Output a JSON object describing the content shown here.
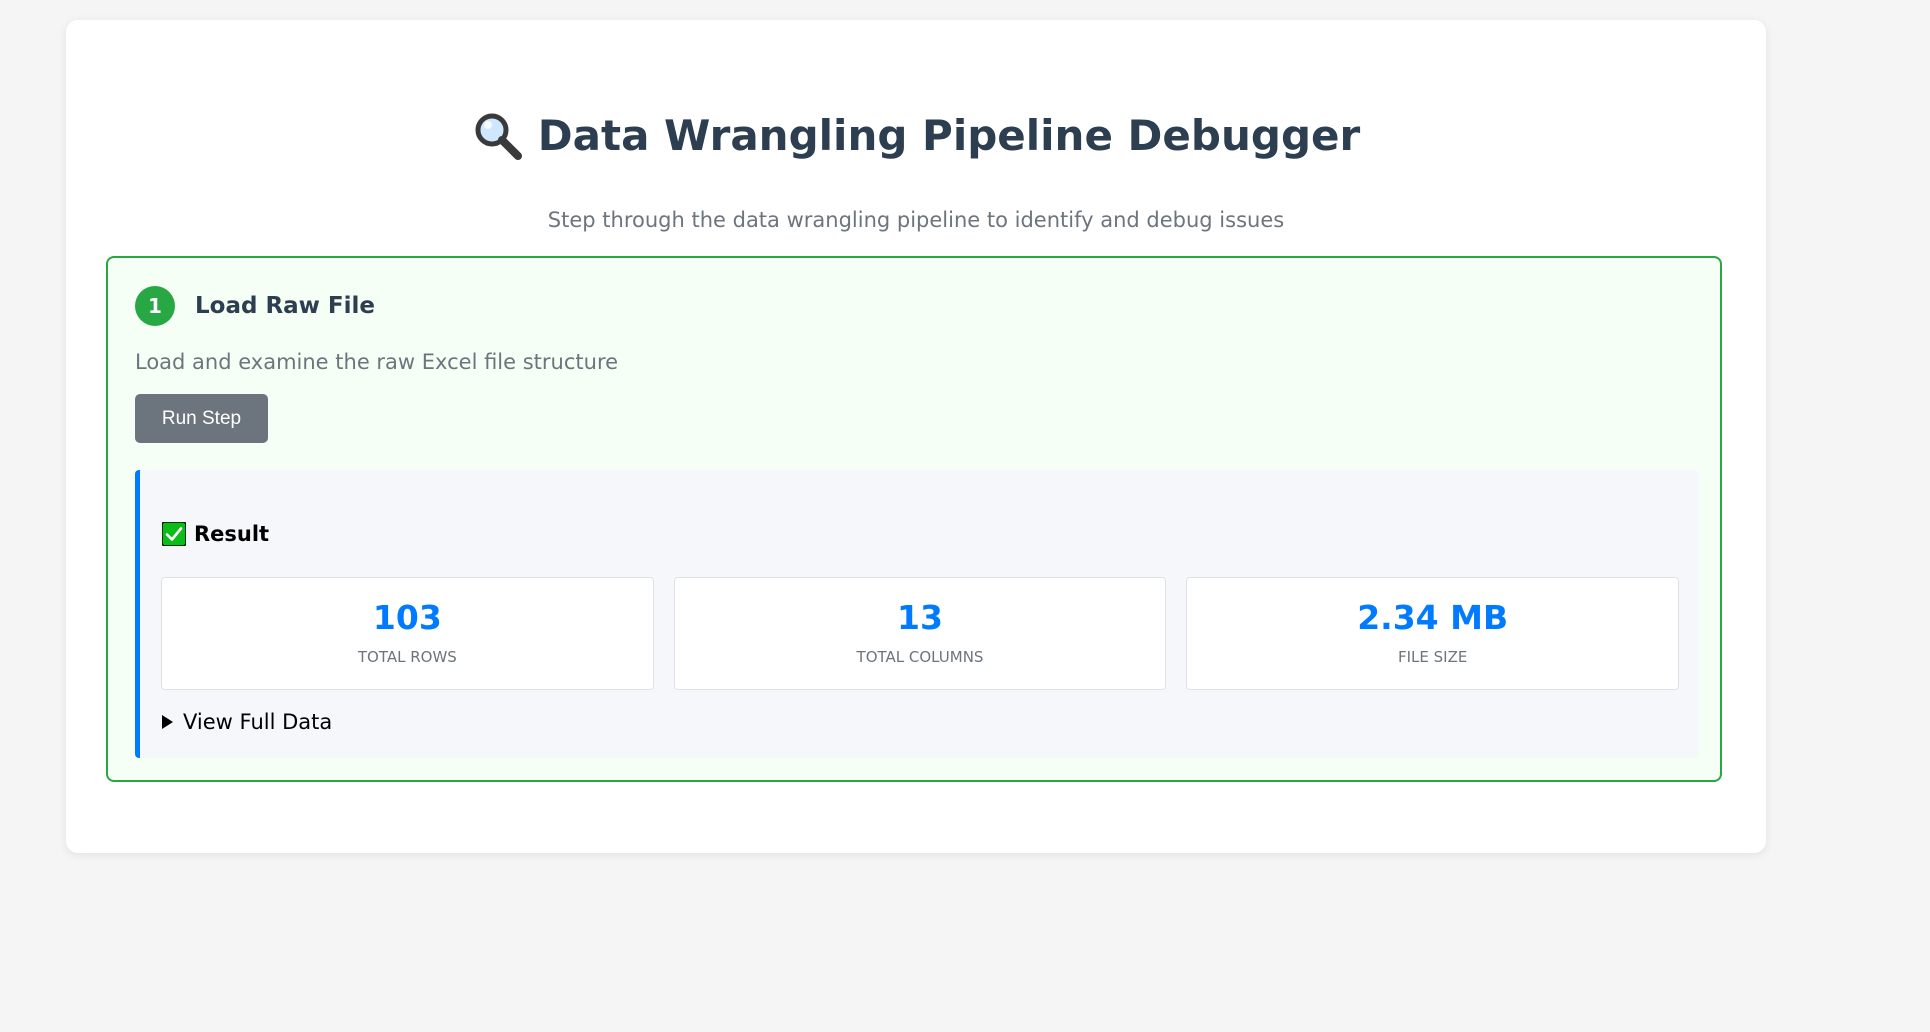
{
  "header": {
    "title": "Data Wrangling Pipeline Debugger",
    "title_icon": "magnifying-glass-icon",
    "subtitle": "Step through the data wrangling pipeline to identify and debug issues"
  },
  "step": {
    "number": "1",
    "title": "Load Raw File",
    "description": "Load and examine the raw Excel file structure",
    "run_button_label": "Run Step",
    "status_color": "#28a745"
  },
  "result": {
    "label": "Result",
    "status_icon": "check-mark-icon",
    "accent_color": "#007bff",
    "stats": [
      {
        "value": "103",
        "label": "Total Rows"
      },
      {
        "value": "13",
        "label": "Total Columns"
      },
      {
        "value": "2.34 MB",
        "label": "File Size"
      }
    ],
    "details_label": "View Full Data"
  }
}
